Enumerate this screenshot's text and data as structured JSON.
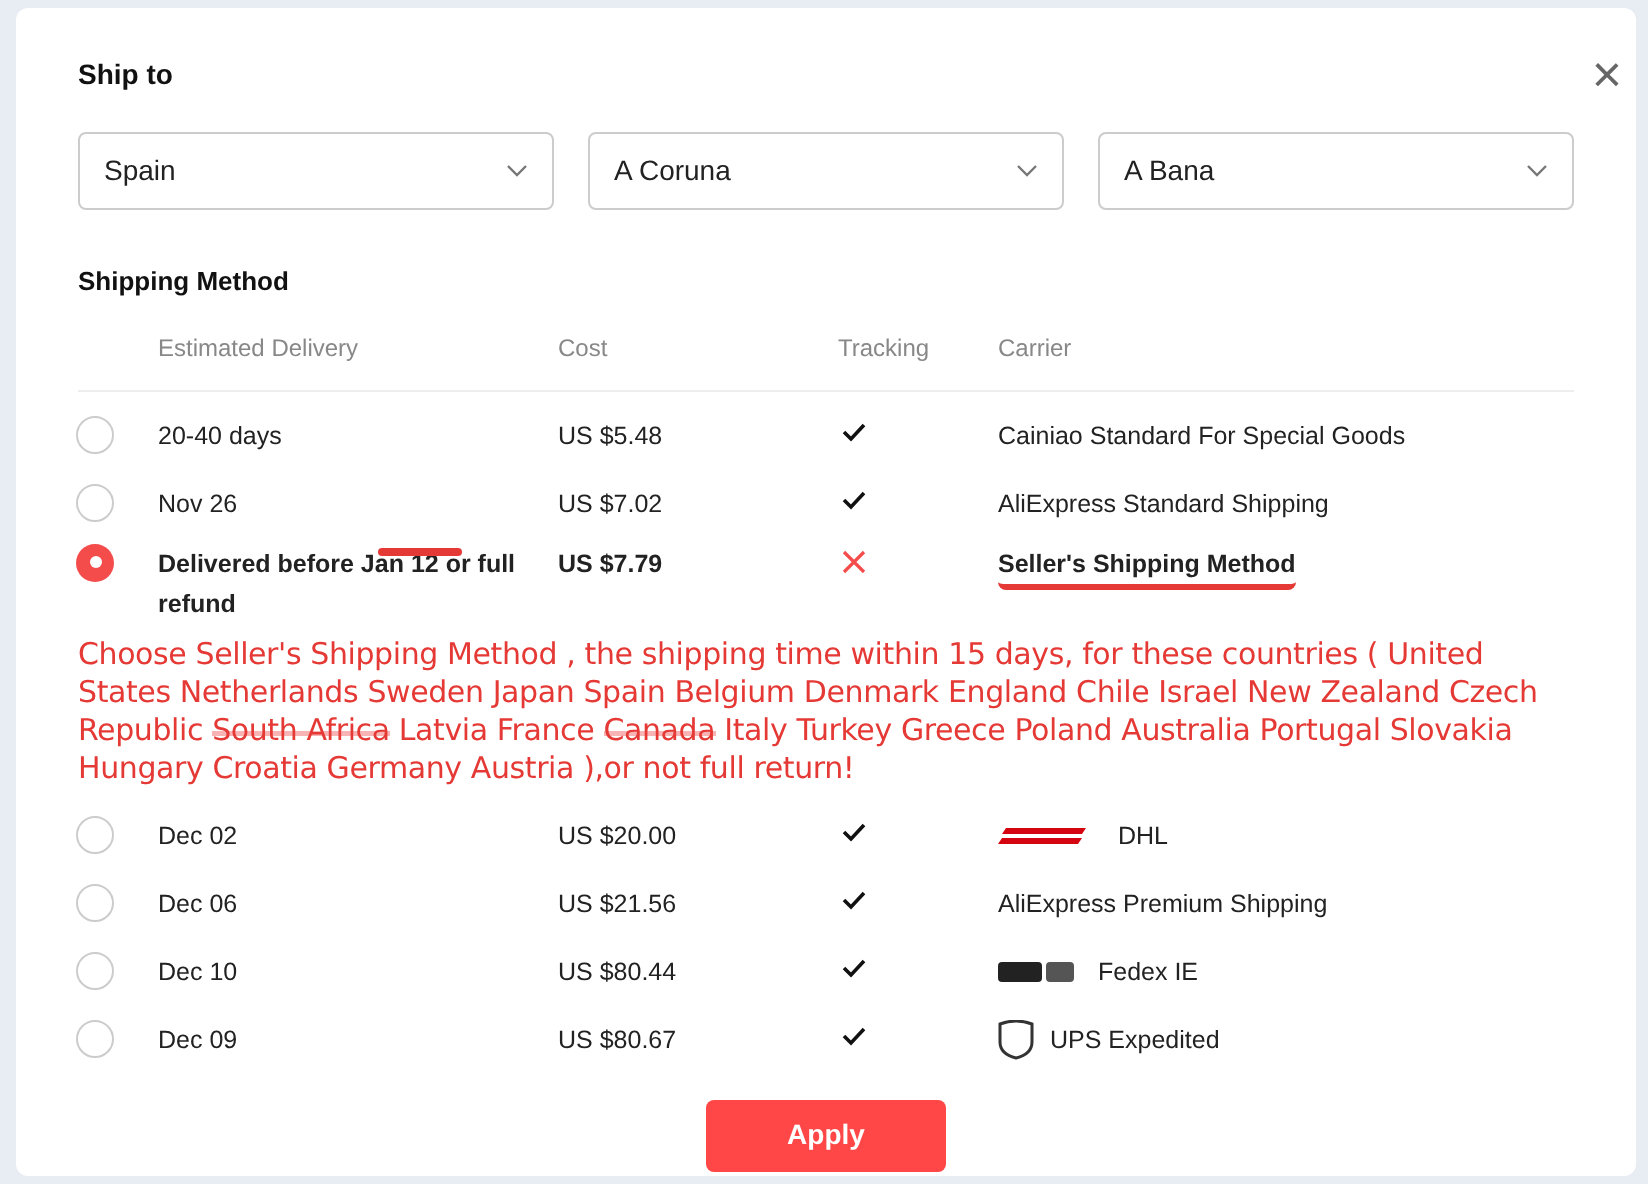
{
  "dialog": {
    "title": "Ship to",
    "close": "×",
    "selects": [
      {
        "value": "Spain"
      },
      {
        "value": "A Coruna"
      },
      {
        "value": "A Bana"
      }
    ],
    "section_title": "Shipping Method",
    "columns": [
      "Estimated Delivery",
      "Cost",
      "Tracking",
      "Carrier"
    ],
    "rows": [
      {
        "delivery": "20-40 days",
        "cost": "US $5.48",
        "tracking": true,
        "carrier": "Cainiao Standard For Special Goods",
        "selected": false
      },
      {
        "delivery": "Nov 26",
        "cost": "US $7.02",
        "tracking": true,
        "carrier": "AliExpress Standard Shipping",
        "selected": false
      },
      {
        "delivery": "Delivered before Jan 12 or full refund",
        "cost": "US $7.79",
        "tracking": false,
        "carrier": "Seller's Shipping Method",
        "selected": true,
        "scribbled": true
      },
      {
        "delivery": "Dec 02",
        "cost": "US $20.00",
        "tracking": true,
        "carrier": "DHL",
        "kind": "dhl",
        "selected": false
      },
      {
        "delivery": "Dec 06",
        "cost": "US $21.56",
        "tracking": true,
        "carrier": "AliExpress Premium Shipping",
        "selected": false
      },
      {
        "delivery": "Dec 10",
        "cost": "US $80.44",
        "tracking": true,
        "carrier": "Fedex IE",
        "kind": "fedex",
        "selected": false
      },
      {
        "delivery": "Dec 09",
        "cost": "US $80.67",
        "tracking": true,
        "carrier": "UPS Expedited",
        "kind": "ups",
        "selected": false
      }
    ],
    "apply": "Apply"
  },
  "annotation": [
    {
      "text": "Choose Seller's Shipping Method , the shipping time within 15 days, for these countries ( United States Netherlands Sweden Japan Spain Belgium Denmark England Chile Israel New Zealand Czech Republic ",
      "struck": false
    },
    {
      "text": "South Africa",
      "struck": true
    },
    {
      "text": " Latvia France ",
      "struck": false
    },
    {
      "text": "Canada",
      "struck": true
    },
    {
      "text": " Italy Turkey Greece Poland  Australia Portugal Slovakia Hungary Croatia Germany Austria ),or not full return!",
      "struck": false
    }
  ]
}
